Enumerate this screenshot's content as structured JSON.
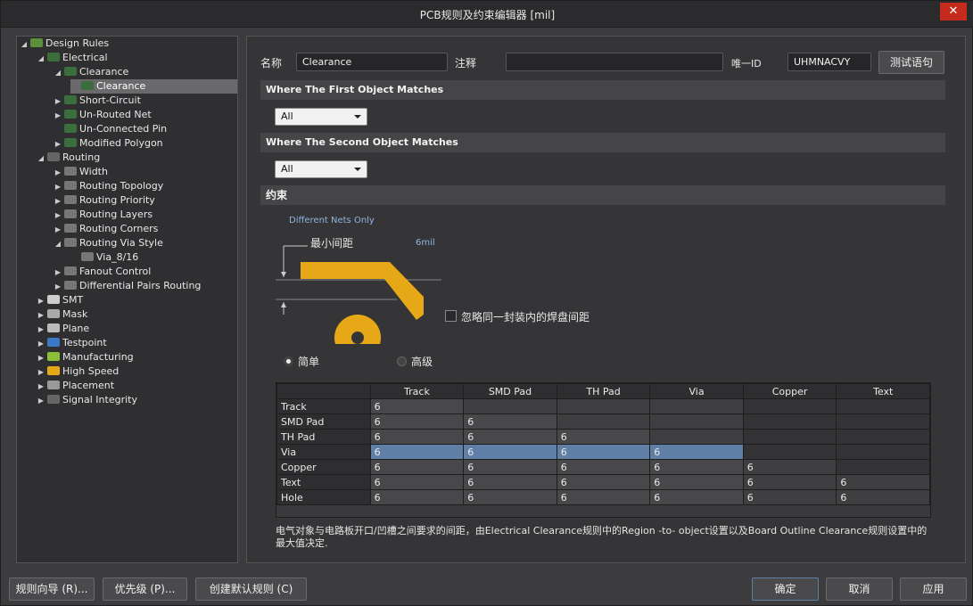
{
  "window": {
    "title": "PCB规则及约束编辑器 [mil]",
    "close": "✕"
  },
  "tree": {
    "root": "Design Rules",
    "electrical": "Electrical",
    "clearance_group": "Clearance",
    "clearance_rule": "Clearance",
    "short_circuit": "Short-Circuit",
    "unrouted_net": "Un-Routed Net",
    "unconnected_pin": "Un-Connected Pin",
    "modified_polygon": "Modified Polygon",
    "routing": "Routing",
    "width": "Width",
    "routing_topology": "Routing Topology",
    "routing_priority": "Routing Priority",
    "routing_layers": "Routing Layers",
    "routing_corners": "Routing Corners",
    "routing_via_style": "Routing Via Style",
    "via_816": "Via_8/16",
    "fanout_control": "Fanout Control",
    "diff_pairs": "Differential Pairs Routing",
    "smt": "SMT",
    "mask": "Mask",
    "plane": "Plane",
    "testpoint": "Testpoint",
    "manufacturing": "Manufacturing",
    "high_speed": "High Speed",
    "placement": "Placement",
    "signal_integrity": "Signal Integrity"
  },
  "rule": {
    "name_label": "名称",
    "name_value": "Clearance",
    "comment_label": "注释",
    "comment_value": "",
    "uid_label": "唯一ID",
    "uid_value": "UHMNACVY",
    "test_button": "测试语句"
  },
  "first_match": {
    "header": "Where The First Object Matches",
    "value": "All"
  },
  "second_match": {
    "header": "Where The Second Object Matches",
    "value": "All"
  },
  "constraints": {
    "header": "约束",
    "net_scope": "Different Nets Only",
    "min_clearance_label": "最小间距",
    "min_clearance_value": "6mil",
    "ignore_pad_label": "忽略同一封装内的焊盘间距",
    "simple_label": "简单",
    "advanced_label": "高级",
    "columns": [
      "Track",
      "SMD Pad",
      "TH Pad",
      "Via",
      "Copper",
      "Text"
    ],
    "rows": [
      {
        "name": "Track",
        "values": [
          "6",
          "",
          "",
          "",
          "",
          ""
        ]
      },
      {
        "name": "SMD Pad",
        "values": [
          "6",
          "6",
          "",
          "",
          "",
          ""
        ]
      },
      {
        "name": "TH Pad",
        "values": [
          "6",
          "6",
          "6",
          "",
          "",
          ""
        ]
      },
      {
        "name": "Via",
        "values": [
          "6",
          "6",
          "6",
          "6",
          "",
          ""
        ]
      },
      {
        "name": "Copper",
        "values": [
          "6",
          "6",
          "6",
          "6",
          "6",
          ""
        ]
      },
      {
        "name": "Text",
        "values": [
          "6",
          "6",
          "6",
          "6",
          "6",
          "6"
        ]
      },
      {
        "name": "Hole",
        "values": [
          "6",
          "6",
          "6",
          "6",
          "6",
          "6"
        ]
      }
    ],
    "note": "电气对象与电路板开口/凹槽之间要求的间距，由Electrical Clearance规则中的Region -to- object设置以及Board Outline Clearance规则设置中的最大值决定."
  },
  "footer": {
    "rule_wizard": "规则向导 (R)...",
    "priorities": "优先级 (P)...",
    "create_default": "创建默认规则 (C)",
    "ok": "确定",
    "cancel": "取消",
    "apply": "应用"
  },
  "colors": {
    "accent": "#e6a817",
    "selection": "#5f7fa6"
  }
}
